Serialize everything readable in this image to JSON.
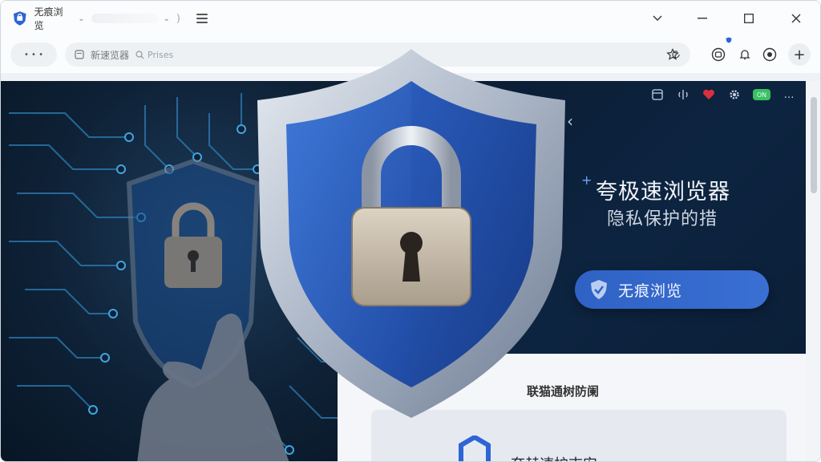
{
  "window": {
    "tab_title": "无痕浏览",
    "tab_caret": "⌄",
    "tab_close": ")",
    "minimize_icon": "chevron-down-icon",
    "buttons": [
      "⌄",
      "—",
      "☐",
      "✕"
    ]
  },
  "navbar": {
    "nav_controls": "• • •",
    "omnibox_label": "新速览器",
    "search_placeholder": "Prises",
    "add_tab": "+"
  },
  "panel": {
    "headline": "夸极速浏览器",
    "subline": "隐私保护的措",
    "cta_label": "无痕浏览",
    "back": "‹",
    "sparkle": "+",
    "toggle_text": "ON",
    "more": "…"
  },
  "bottom": {
    "heading": "联猫通树防阑",
    "inner_title": "夸赫速护志安"
  },
  "colors": {
    "accent": "#2f62c4",
    "panel_bg": "#0a1a30",
    "shield_blue": "#2a58b8",
    "shield_silver": "#b8c2d2"
  }
}
